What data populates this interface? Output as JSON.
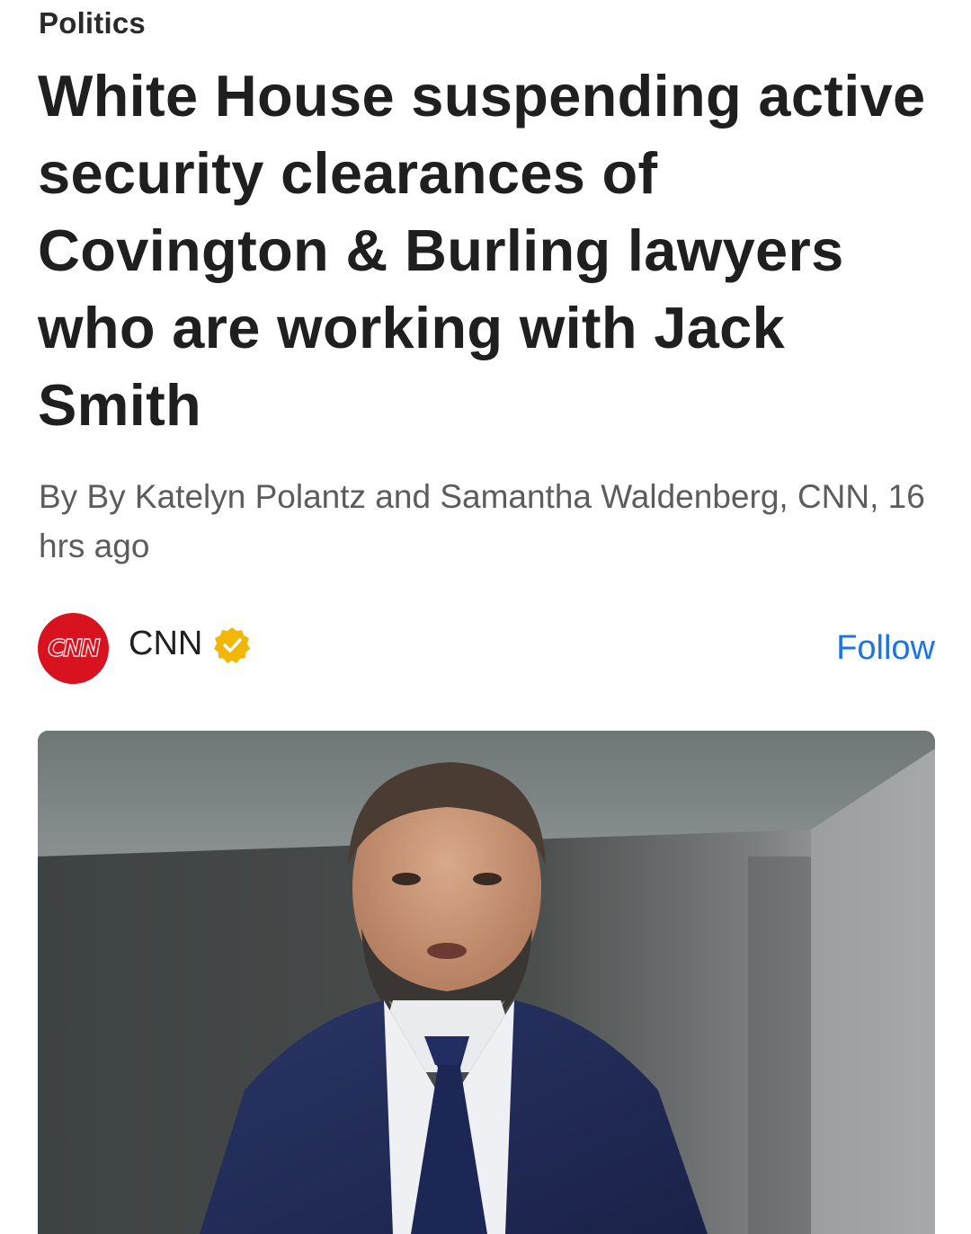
{
  "article": {
    "category": "Politics",
    "headline": "White House suspending active security clearances of Covington & Burling lawyers who are working with Jack Smith",
    "byline": "By By Katelyn Polantz and Samantha Waldenberg, CNN, 16 hrs ago"
  },
  "publisher": {
    "logo_text": "CNN",
    "name": "CNN",
    "verified_icon": "verified-badge-icon",
    "follow_label": "Follow"
  },
  "colors": {
    "follow_blue": "#1a73e8",
    "cnn_red": "#d8131f",
    "verified_gold": "#f2b705"
  },
  "image": {
    "icon": "article-photo"
  }
}
